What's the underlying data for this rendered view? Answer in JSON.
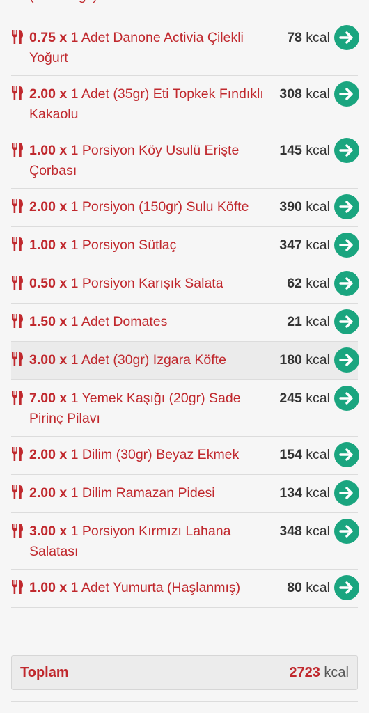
{
  "partial_item": {
    "name": "(Tam Yağlı)"
  },
  "items": [
    {
      "qty": "0.75 x",
      "desc": " 1 Adet Danone Activia Çilekli Yoğurt",
      "kcal": "78",
      "unit": " kcal"
    },
    {
      "qty": "2.00 x",
      "desc": " 1 Adet (35gr) Eti Topkek Fındıklı Kakaolu",
      "kcal": "308",
      "unit": " kcal"
    },
    {
      "qty": "1.00 x",
      "desc": " 1 Porsiyon Köy Usulü Erişte Çorbası",
      "kcal": "145",
      "unit": " kcal"
    },
    {
      "qty": "2.00 x",
      "desc": " 1 Porsiyon (150gr) Sulu Köfte",
      "kcal": "390",
      "unit": " kcal"
    },
    {
      "qty": "1.00 x",
      "desc": " 1 Porsiyon Sütlaç",
      "kcal": "347",
      "unit": " kcal"
    },
    {
      "qty": "0.50 x",
      "desc": " 1 Porsiyon Karışık Salata",
      "kcal": "62",
      "unit": " kcal"
    },
    {
      "qty": "1.50 x",
      "desc": " 1 Adet Domates",
      "kcal": "21",
      "unit": " kcal"
    },
    {
      "qty": "3.00 x",
      "desc": " 1 Adet (30gr) Izgara Köfte",
      "kcal": "180",
      "unit": " kcal",
      "highlight": true
    },
    {
      "qty": "7.00 x",
      "desc": " 1 Yemek Kaşığı (20gr) Sade Pirinç Pilavı",
      "kcal": "245",
      "unit": " kcal"
    },
    {
      "qty": "2.00 x",
      "desc": " 1 Dilim (30gr) Beyaz Ekmek",
      "kcal": "154",
      "unit": " kcal"
    },
    {
      "qty": "2.00 x",
      "desc": " 1 Dilim Ramazan Pidesi",
      "kcal": "134",
      "unit": " kcal"
    },
    {
      "qty": "3.00 x",
      "desc": " 1 Porsiyon Kırmızı Lahana Salatası",
      "kcal": "348",
      "unit": " kcal"
    },
    {
      "qty": "1.00 x",
      "desc": " 1 Adet Yumurta (Haşlanmış)",
      "kcal": "80",
      "unit": " kcal"
    }
  ],
  "total": {
    "label": "Toplam",
    "value": "2723",
    "unit": " kcal"
  },
  "colors": {
    "accent": "#c0282d",
    "go_button": "#1aa57f"
  },
  "icons": {
    "item": "fork-knife-icon",
    "action": "arrow-right-icon"
  }
}
